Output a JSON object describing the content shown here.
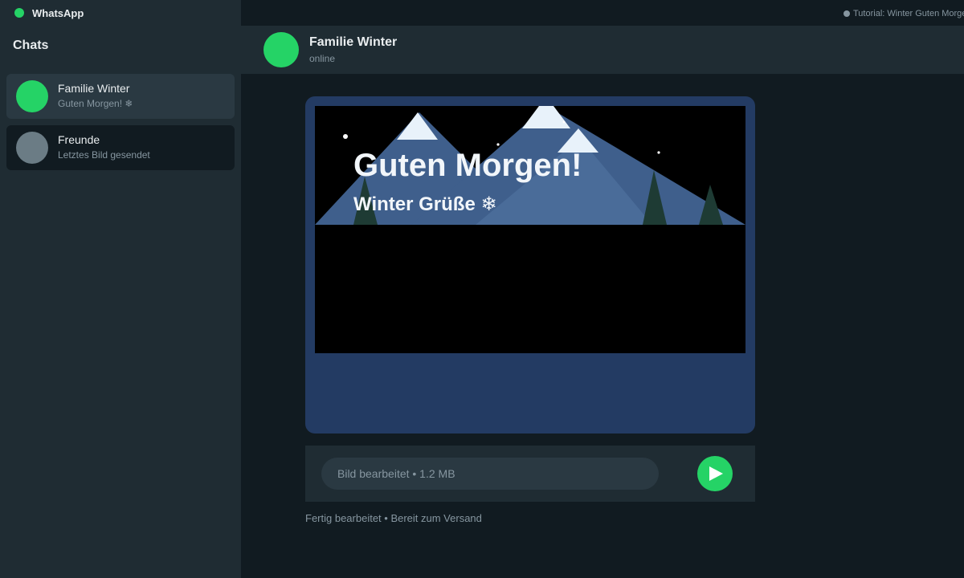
{
  "app": {
    "name": "WhatsApp",
    "brand_color": "#25d366",
    "tutorial_label": "Tutorial: Winter Guten Morgen"
  },
  "sidebar": {
    "title": "Chats",
    "chats": [
      {
        "name": "Familie Winter",
        "preview": "Guten Morgen! ❄",
        "avatar_color": "#25d366",
        "active": true
      },
      {
        "name": "Freunde",
        "preview": "Letztes Bild gesendet",
        "avatar_color": "#6b7c85",
        "active": false
      }
    ]
  },
  "header": {
    "name": "Familie Winter",
    "status": "online"
  },
  "message": {
    "image_title": "Guten Morgen!",
    "image_subtitle": "Winter Grüße ❄"
  },
  "composer": {
    "value": "Bild bearbeitet • 1.2 MB",
    "send_icon": "send-icon"
  },
  "footer": {
    "status": "Fertig bearbeitet • Bereit zum Versand"
  }
}
